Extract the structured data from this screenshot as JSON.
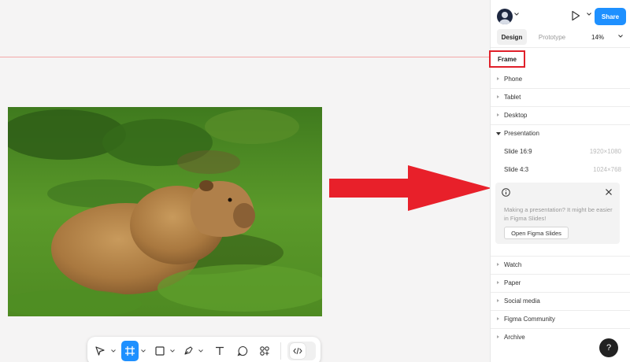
{
  "panel": {
    "share_label": "Share",
    "tabs": [
      {
        "label": "Design",
        "active": true
      },
      {
        "label": "Prototype",
        "active": false
      }
    ],
    "zoom": "14%",
    "frame_label": "Frame",
    "sections": [
      {
        "label": "Phone",
        "expanded": false
      },
      {
        "label": "Tablet",
        "expanded": false
      },
      {
        "label": "Desktop",
        "expanded": false
      },
      {
        "label": "Presentation",
        "expanded": true
      }
    ],
    "presets": [
      {
        "label": "Slide 16:9",
        "dims": "1920×1080"
      },
      {
        "label": "Slide 4:3",
        "dims": "1024×768"
      }
    ],
    "notice": {
      "text": "Making a presentation? It might be easier in Figma Slides!",
      "button": "Open Figma Slides"
    },
    "sections_after": [
      {
        "label": "Watch"
      },
      {
        "label": "Paper"
      },
      {
        "label": "Social media"
      },
      {
        "label": "Figma Community"
      },
      {
        "label": "Archive"
      }
    ],
    "help_label": "?"
  },
  "toolbar": {
    "tools": [
      "move-tool",
      "frame-tool",
      "shape-tool",
      "pen-tool",
      "text-tool",
      "comment-tool",
      "actions-tool",
      "dev-mode-toggle"
    ],
    "active_tool": "frame-tool"
  },
  "colors": {
    "accent": "#1e90ff",
    "highlight": "#e0202a",
    "arrow": "#e8202a"
  }
}
